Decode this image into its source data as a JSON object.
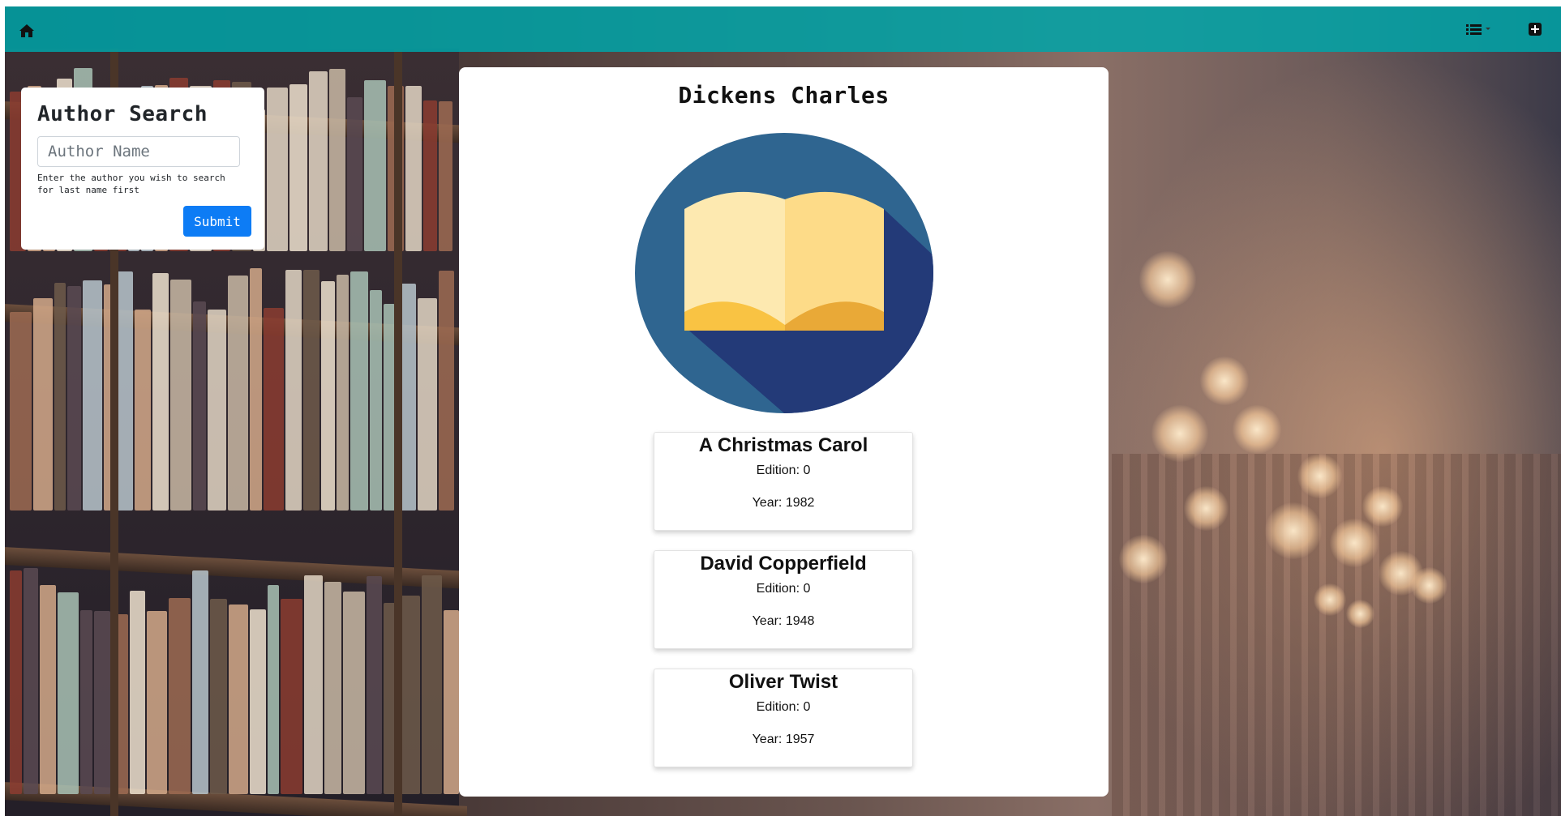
{
  "nav": {
    "home_icon": "home-icon",
    "list_icon": "list-dropdown-icon",
    "add_icon": "plus-square-icon",
    "bar_color": "#00a4a8"
  },
  "search": {
    "title": "Author Search",
    "placeholder": "Author Name",
    "value": "",
    "help_text": "Enter the author you wish to search for last name first",
    "submit_label": "Submit"
  },
  "author": {
    "name": "Dickens Charles",
    "logo_icon": "open-book-icon"
  },
  "books": [
    {
      "title": "A Christmas Carol",
      "edition": "Edition: 0",
      "year": "Year: 1982"
    },
    {
      "title": "David Copperfield",
      "edition": "Edition: 0",
      "year": "Year: 1948"
    },
    {
      "title": "Oliver Twist",
      "edition": "Edition: 0",
      "year": "Year: 1957"
    }
  ]
}
